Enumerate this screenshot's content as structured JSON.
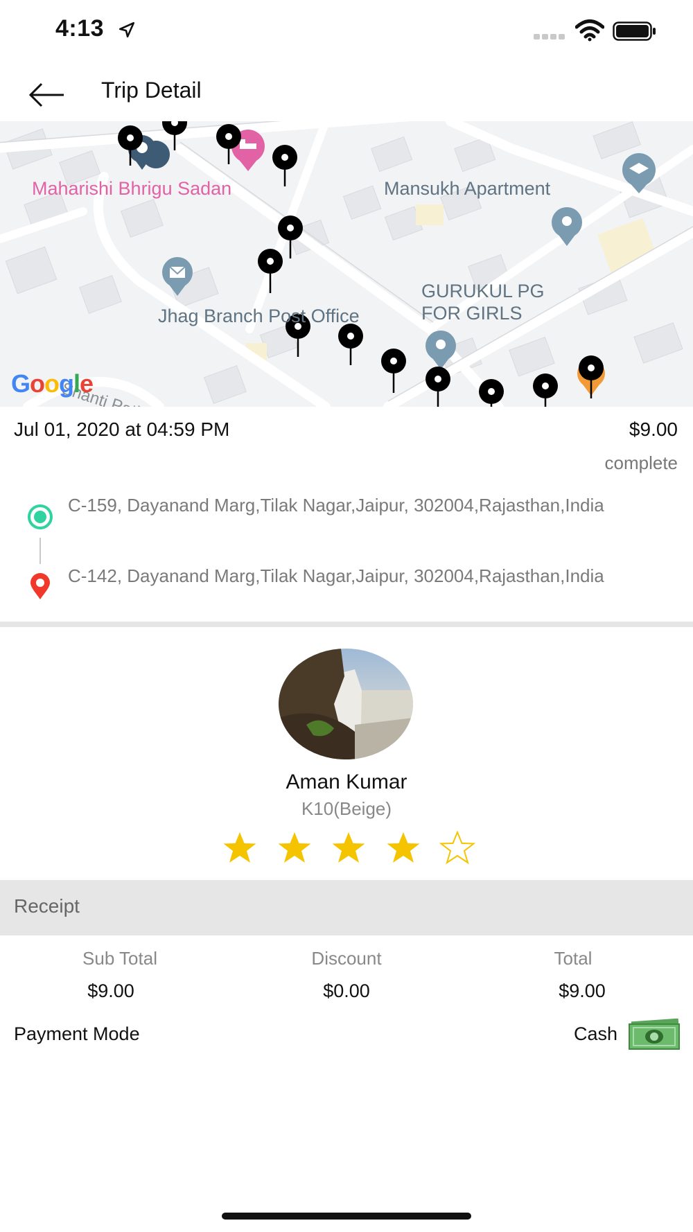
{
  "status_bar": {
    "time": "4:13",
    "icons": [
      "location-arrow-icon",
      "signal-icon",
      "wifi-icon",
      "battery-icon"
    ]
  },
  "nav": {
    "title": "Trip Detail",
    "back_icon": "arrow-left-icon"
  },
  "map": {
    "labels": {
      "place1": "Maharishi Bhrigu Sadan",
      "place2": "Mansukh Apartment",
      "place3_line1": "GURUKUL PG",
      "place3_line2": "FOR GIRLS",
      "place4": "Jhag Branch Post Office",
      "street": "Shanti Path"
    },
    "logo": "Google",
    "colors": {
      "poi_pink": "#e262a6",
      "poi_gray": "#5f7d92",
      "route_pin": "#000000",
      "end_pin": "#f29b36"
    }
  },
  "trip": {
    "date": "Jul 01, 2020 at 04:59 PM",
    "price": "$9.00",
    "status": "complete",
    "pickup_address": "C-159, Dayanand Marg,Tilak Nagar,Jaipur, 302004,Rajasthan,India",
    "drop_address": "C-142, Dayanand Marg,Tilak Nagar,Jaipur, 302004,Rajasthan,India",
    "pickup_color": "#2fd3a0",
    "drop_color": "#f0392b"
  },
  "driver": {
    "name": "Aman Kumar",
    "vehicle": "K10(Beige)",
    "rating": 4,
    "rating_max": 5,
    "star_color": "#f5c400"
  },
  "receipt": {
    "title": "Receipt",
    "sub_total_label": "Sub Total",
    "sub_total": "$9.00",
    "discount_label": "Discount",
    "discount": "$0.00",
    "total_label": "Total",
    "total": "$9.00",
    "payment_mode_label": "Payment Mode",
    "payment_mode": "Cash",
    "payment_icon": "cash-icon"
  }
}
